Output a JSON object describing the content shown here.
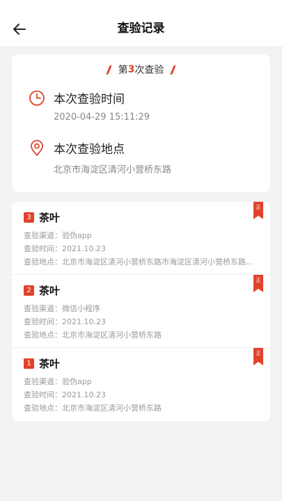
{
  "header": {
    "title": "查验记录"
  },
  "summary": {
    "count_prefix": "第",
    "count_num": "3",
    "count_suffix": "次查验",
    "time_label": "本次查验时间",
    "time_value": "2020-04-29 15:11:29",
    "place_label": "本次查验地点",
    "place_value": "北京市海淀区清河小营桥东路"
  },
  "records": [
    {
      "index": "3",
      "name": "茶叶",
      "tag": "正",
      "channel": "查验渠道：验伪app",
      "time": "查验时间：2021.10.23",
      "place": "查验地点：北京市海淀区清河小营桥东路市海淀区清河小营桥东路..."
    },
    {
      "index": "2",
      "name": "茶叶",
      "tag": "正",
      "channel": "查验渠道：微信小程序",
      "time": "查验时间：2021.10.23",
      "place": "查验地点：北京市海淀区清河小营桥东路"
    },
    {
      "index": "1",
      "name": "茶叶",
      "tag": "正",
      "channel": "查验渠道：验伪app",
      "time": "查验时间：2021.10.23",
      "place": "查验地点：北京市海淀区清河小营桥东路"
    }
  ],
  "colors": {
    "accent": "#e0432b",
    "background": "#f3f3f3"
  },
  "icons": {
    "back": "arrow-left-icon",
    "time": "clock-icon",
    "place": "location-pin-icon"
  }
}
